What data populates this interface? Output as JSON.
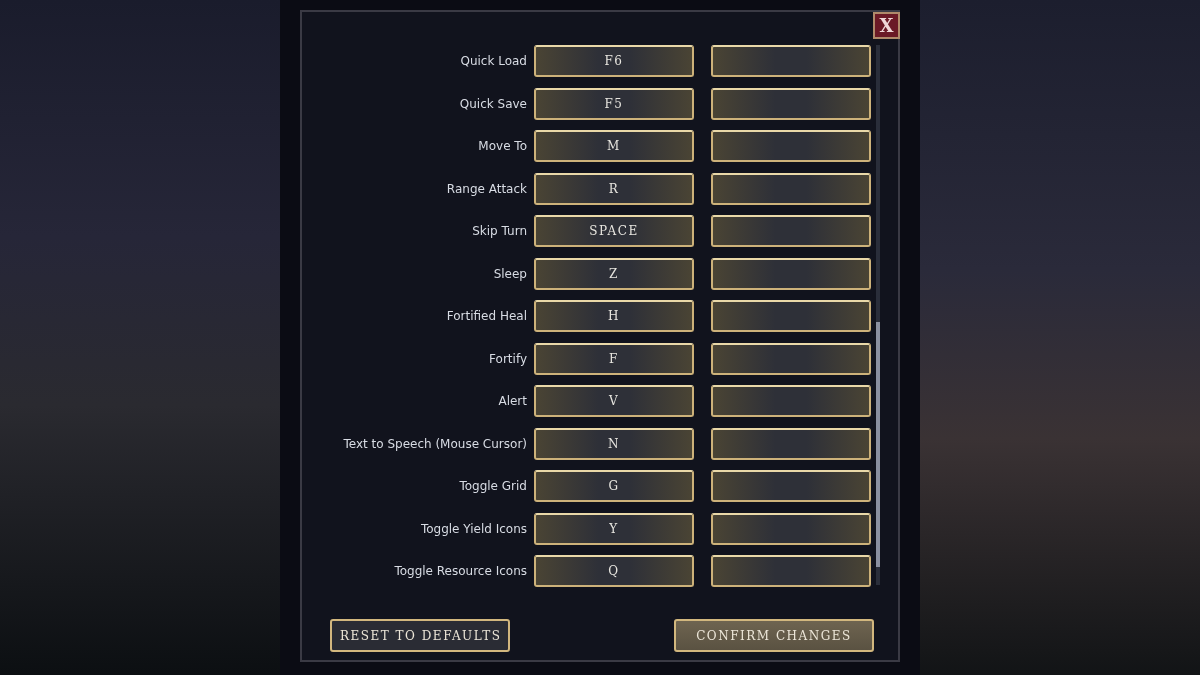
{
  "close_button": "X",
  "bindings": [
    {
      "action": "Quick Load",
      "primary": "F6"
    },
    {
      "action": "Quick Save",
      "primary": "F5"
    },
    {
      "action": "Move To",
      "primary": "M"
    },
    {
      "action": "Range Attack",
      "primary": "R"
    },
    {
      "action": "Skip Turn",
      "primary": "SPACE"
    },
    {
      "action": "Sleep",
      "primary": "Z"
    },
    {
      "action": "Fortified Heal",
      "primary": "H"
    },
    {
      "action": "Fortify",
      "primary": "F"
    },
    {
      "action": "Alert",
      "primary": "V"
    },
    {
      "action": "Text to Speech (Mouse Cursor)",
      "primary": "N"
    },
    {
      "action": "Toggle Grid",
      "primary": "G"
    },
    {
      "action": "Toggle Yield Icons",
      "primary": "Y"
    },
    {
      "action": "Toggle Resource Icons",
      "primary": "Q"
    }
  ],
  "buttons": [
    {
      "label": "RESET TO DEFAULTS",
      "kind": "secondary"
    },
    {
      "label": "CONFIRM CHANGES",
      "kind": "primary"
    }
  ]
}
